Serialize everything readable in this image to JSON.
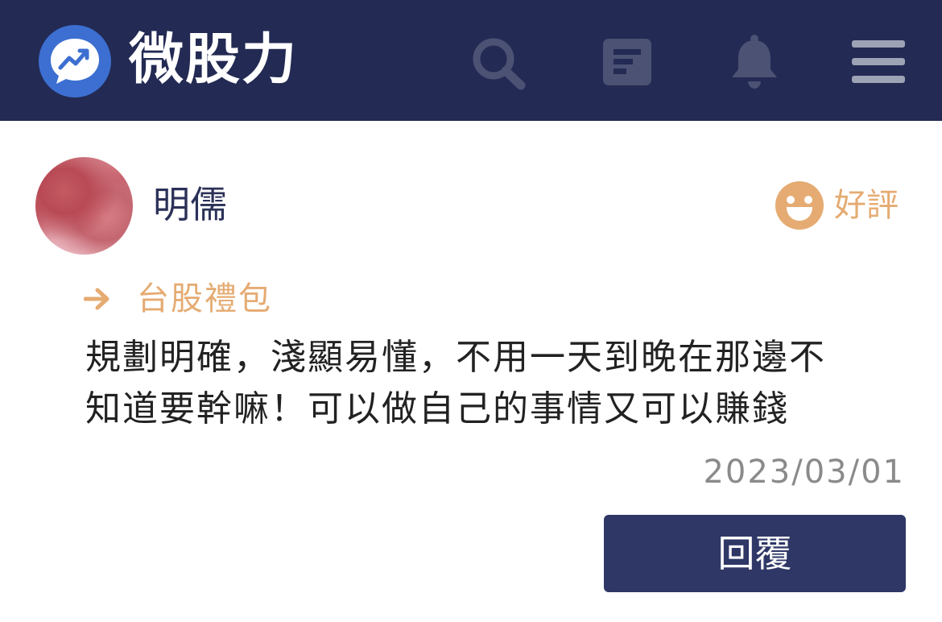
{
  "header": {
    "brand": "微股力",
    "icons": {
      "logo": "chat-bubble-trend-logo",
      "search": "search-icon",
      "document": "document-icon",
      "notifications": "bell-icon",
      "menu": "hamburger-menu-icon"
    },
    "background_color": "#232a53",
    "icon_color": "#4b5274"
  },
  "review": {
    "author": "明儒",
    "rating_label": "好評",
    "rating_icon": "smiley-face-icon",
    "product_arrow_icon": "arrow-right-icon",
    "product": "台股禮包",
    "comment_lines": [
      "規劃明確，淺顯易懂，不用一天到晚在那邊不",
      "知道要幹嘛！可以做自己的事情又可以賺錢"
    ],
    "date": "2023/03/01",
    "reply_label": "回覆",
    "accent_color": "#e5ab72",
    "button_color": "#2e3766"
  }
}
